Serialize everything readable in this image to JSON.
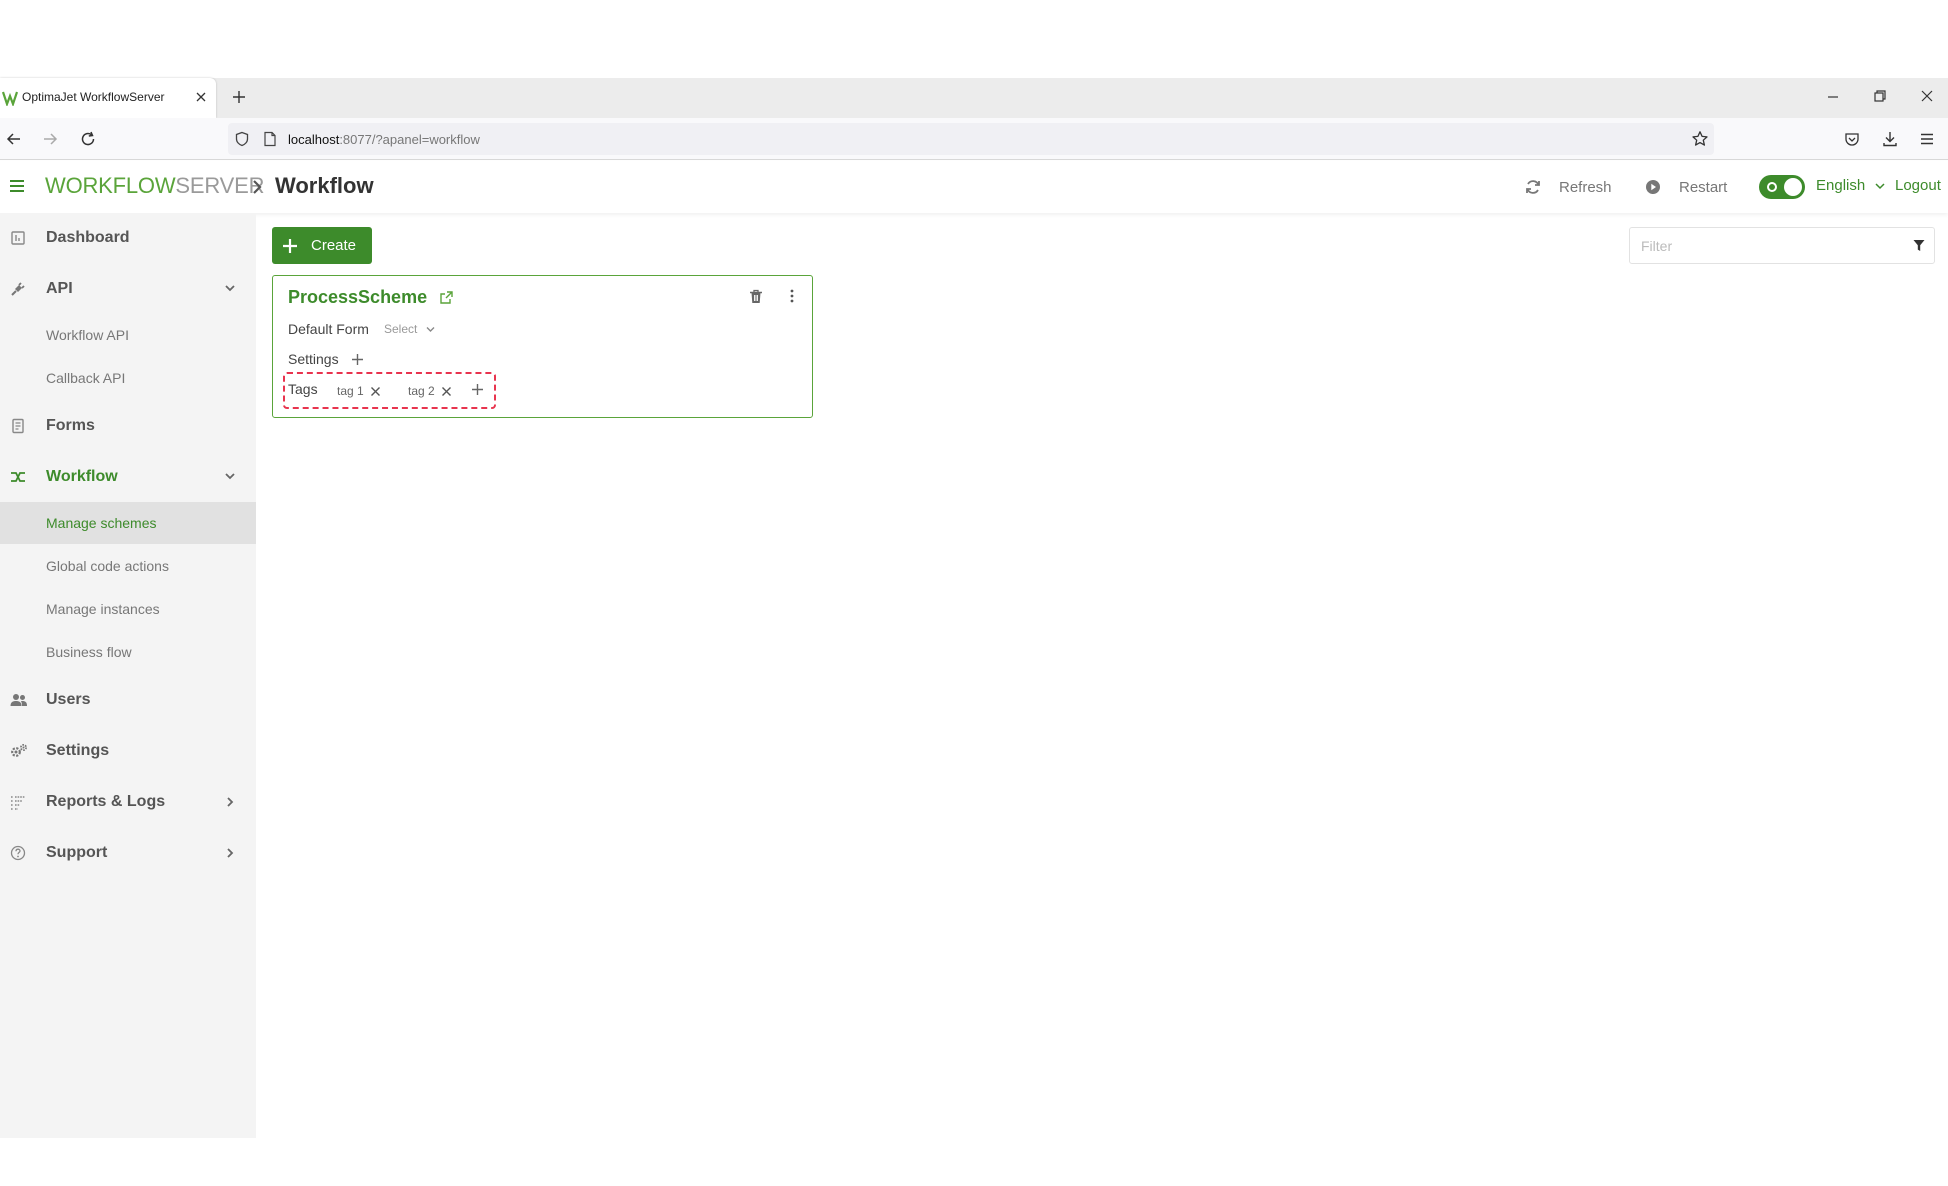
{
  "browser": {
    "tab_title": "OptimaJet WorkflowServer",
    "url_host": "localhost",
    "url_rest": ":8077/?apanel=workflow"
  },
  "header": {
    "brand_part1": "WORKFLOW",
    "brand_part2": "SERVER",
    "page_title": "Workflow",
    "refresh_label": "Refresh",
    "restart_label": "Restart",
    "language": "English",
    "logout_label": "Logout"
  },
  "sidebar": {
    "dashboard": "Dashboard",
    "api": "API",
    "workflow_api": "Workflow API",
    "callback_api": "Callback API",
    "forms": "Forms",
    "workflow": "Workflow",
    "manage_schemes": "Manage schemes",
    "global_code_actions": "Global code actions",
    "manage_instances": "Manage instances",
    "business_flow": "Business flow",
    "users": "Users",
    "settings": "Settings",
    "reports_logs": "Reports & Logs",
    "support": "Support"
  },
  "main": {
    "create_label": "Create",
    "filter_placeholder": "Filter",
    "card": {
      "scheme_name": "ProcessScheme",
      "default_form_label": "Default Form",
      "form_select": "Select",
      "settings_label": "Settings",
      "tags_label": "Tags",
      "tags": [
        "tag 1",
        "tag 2"
      ]
    }
  },
  "colors": {
    "accent": "#3d8b2b",
    "brand_green": "#5aa43a",
    "highlight": "#e8344e",
    "sidebar_bg": "#f4f4f4"
  }
}
